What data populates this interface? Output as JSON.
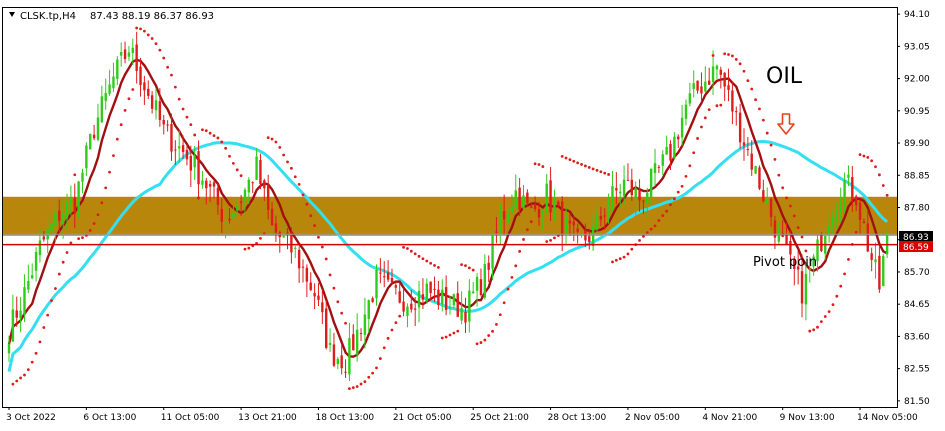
{
  "header": {
    "symbol_label": "CLSK.tp,H4",
    "ohlc_label": "87.43 88.19 86.37 86.93",
    "menu_arrow": "triangle-down-icon"
  },
  "annotations": {
    "instrument_text": "OIL",
    "pivot_text": "Pivot poin",
    "arrow_icon": "arrow-down-icon"
  },
  "colors": {
    "bull_candle": "#2ecc1a",
    "bear_candle": "#e01b1b",
    "sar_dots": "#e01b1b",
    "ma_fast": "#a01010",
    "ma_slow": "#33dff0",
    "zone_fill": "#b8860b",
    "pivot_line": "#d90000",
    "price_tag_bg": "#000000",
    "pivot_tag_bg": "#d90000",
    "arrow": "#e8401e"
  },
  "chart_data": {
    "type": "candlestick",
    "title": "",
    "ylim": [
      81.3,
      94.3
    ],
    "y_ticks": [
      "94.10",
      "93.05",
      "92.00",
      "90.95",
      "89.90",
      "88.85",
      "87.80",
      "86.75",
      "85.70",
      "84.65",
      "83.60",
      "82.55",
      "81.50"
    ],
    "x_ticks": [
      {
        "label": "3 Oct 2022",
        "bar": 0
      },
      {
        "label": "6 Oct 13:00",
        "bar": 20
      },
      {
        "label": "11 Oct 05:00",
        "bar": 40
      },
      {
        "label": "13 Oct 21:00",
        "bar": 60
      },
      {
        "label": "18 Oct 13:00",
        "bar": 80
      },
      {
        "label": "21 Oct 05:00",
        "bar": 100
      },
      {
        "label": "25 Oct 21:00",
        "bar": 120
      },
      {
        "label": "28 Oct 13:00",
        "bar": 140
      },
      {
        "label": "2 Nov 05:00",
        "bar": 160
      },
      {
        "label": "4 Nov 21:00",
        "bar": 180
      },
      {
        "label": "9 Nov 13:00",
        "bar": 200
      },
      {
        "label": "14 Nov 05:00",
        "bar": 220
      }
    ],
    "price_anchors": [
      [
        0,
        83.8
      ],
      [
        4,
        85.0
      ],
      [
        8,
        86.5
      ],
      [
        13,
        87.6
      ],
      [
        17,
        88.0
      ],
      [
        22,
        90.4
      ],
      [
        27,
        92.0
      ],
      [
        31,
        93.0
      ],
      [
        36,
        91.5
      ],
      [
        40,
        90.3
      ],
      [
        45,
        89.6
      ],
      [
        50,
        88.8
      ],
      [
        56,
        87.4
      ],
      [
        60,
        88.1
      ],
      [
        64,
        89.1
      ],
      [
        68,
        87.1
      ],
      [
        74,
        86.3
      ],
      [
        79,
        85.0
      ],
      [
        83,
        83.1
      ],
      [
        87,
        82.8
      ],
      [
        91,
        84.0
      ],
      [
        95,
        85.4
      ],
      [
        99,
        85.0
      ],
      [
        103,
        84.8
      ],
      [
        108,
        85.1
      ],
      [
        113,
        84.7
      ],
      [
        118,
        84.5
      ],
      [
        123,
        85.6
      ],
      [
        127,
        87.4
      ],
      [
        131,
        88.3
      ],
      [
        135,
        87.6
      ],
      [
        139,
        88.2
      ],
      [
        143,
        87.3
      ],
      [
        147,
        86.6
      ],
      [
        151,
        87.0
      ],
      [
        155,
        88.0
      ],
      [
        159,
        88.6
      ],
      [
        163,
        88.1
      ],
      [
        167,
        88.8
      ],
      [
        171,
        89.6
      ],
      [
        175,
        91.1
      ],
      [
        179,
        91.8
      ],
      [
        183,
        92.4
      ],
      [
        186,
        91.4
      ],
      [
        190,
        90.0
      ],
      [
        194,
        88.6
      ],
      [
        198,
        87.2
      ],
      [
        202,
        85.9
      ],
      [
        205,
        85.1
      ],
      [
        208,
        86.0
      ],
      [
        212,
        87.6
      ],
      [
        216,
        88.6
      ],
      [
        219,
        88.2
      ],
      [
        222,
        86.6
      ],
      [
        225,
        85.2
      ],
      [
        227,
        86.93
      ]
    ],
    "total_bars": 228,
    "zone": {
      "low": 86.88,
      "high": 88.15
    },
    "pivot_level": 86.59,
    "current_price": 86.93,
    "price_tags": {
      "current": "86.93",
      "pivot": "86.59"
    },
    "series": [
      {
        "indicator": "moving-average-fast",
        "period": 7
      },
      {
        "indicator": "moving-average-slow",
        "period": 100
      },
      {
        "indicator": "parabolic-sar"
      }
    ]
  }
}
